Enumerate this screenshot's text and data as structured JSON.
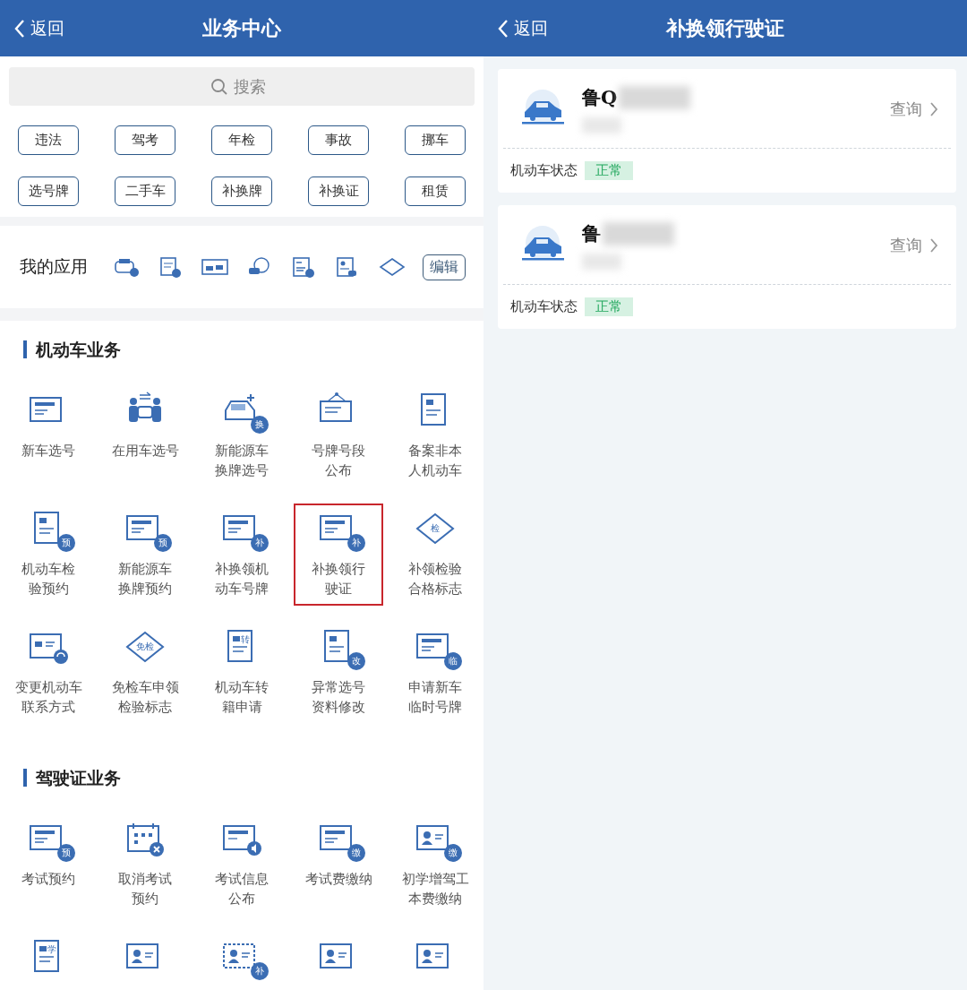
{
  "left": {
    "header": {
      "back": "返回",
      "title": "业务中心"
    },
    "search": {
      "placeholder": "搜索"
    },
    "tags": [
      "违法",
      "驾考",
      "年检",
      "事故",
      "挪车",
      "选号牌",
      "二手车",
      "补换牌",
      "补换证",
      "租赁"
    ],
    "my_apps": {
      "title": "我的应用",
      "edit": "编辑"
    },
    "sections": [
      {
        "title": "机动车业务",
        "items": [
          {
            "label": "新车选号",
            "selected": false
          },
          {
            "label": "在用车选号",
            "selected": false
          },
          {
            "label": "新能源车换牌选号",
            "badge": "换",
            "selected": false
          },
          {
            "label": "号牌号段公布",
            "selected": false
          },
          {
            "label": "备案非本人机动车",
            "selected": false
          },
          {
            "label": "机动车检验预约",
            "badge": "预",
            "selected": false
          },
          {
            "label": "新能源车换牌预约",
            "badge": "预",
            "selected": false
          },
          {
            "label": "补换领机动车号牌",
            "badge": "补",
            "selected": false
          },
          {
            "label": "补换领行驶证",
            "badge": "补",
            "selected": true
          },
          {
            "label": "补领检验合格标志",
            "badge": "检",
            "selected": false
          },
          {
            "label": "变更机动车联系方式",
            "selected": false
          },
          {
            "label": "免检车申领检验标志",
            "badge": "免检",
            "selected": false
          },
          {
            "label": "机动车转籍申请",
            "badge": "转",
            "selected": false
          },
          {
            "label": "异常选号资料修改",
            "badge": "改",
            "selected": false
          },
          {
            "label": "申请新车临时号牌",
            "badge": "临",
            "selected": false
          }
        ]
      },
      {
        "title": "驾驶证业务",
        "items": [
          {
            "label": "考试预约",
            "badge": "预",
            "selected": false
          },
          {
            "label": "取消考试预约",
            "selected": false
          },
          {
            "label": "考试信息公布",
            "selected": false
          },
          {
            "label": "考试费缴纳",
            "badge": "缴",
            "selected": false
          },
          {
            "label": "初学增驾工本费缴纳",
            "badge": "缴",
            "selected": false
          },
          {
            "badge": "学",
            "selected": false
          },
          {
            "selected": false
          },
          {
            "badge": "补",
            "selected": false
          },
          {
            "selected": false
          },
          {
            "selected": false
          }
        ]
      }
    ]
  },
  "right": {
    "header": {
      "back": "返回",
      "title": "补换领行驶证"
    },
    "vehicles": [
      {
        "plate": "鲁Q",
        "action": "查询",
        "status_label": "机动车状态",
        "status": "正常"
      },
      {
        "plate": "鲁",
        "action": "查询",
        "status_label": "机动车状态",
        "status": "正常"
      }
    ]
  }
}
